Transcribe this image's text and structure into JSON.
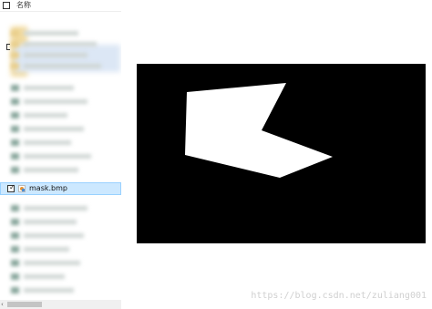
{
  "explorer": {
    "header": {
      "label": "名称",
      "select_all_checked": false
    },
    "selected_file": {
      "name": "mask.bmp",
      "checked": true,
      "check_glyph": "✓",
      "icon": "bmp-image-icon"
    },
    "scrollbar": {
      "left_arrow": "‹"
    }
  },
  "image": {
    "background_color": "#000000",
    "shape_color": "#ffffff",
    "shape_description": "white polygon mask on black"
  },
  "watermark": {
    "text": "https://blog.csdn.net/zuliang001"
  },
  "colors": {
    "selection_bg": "#cce8ff",
    "selection_border": "#99d1ff"
  }
}
